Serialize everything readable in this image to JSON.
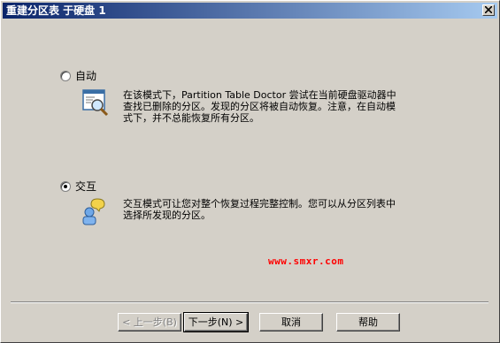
{
  "window": {
    "title": "重建分区表 于硬盘 1"
  },
  "options": [
    {
      "label": "自动",
      "checked": false,
      "description": [
        "在该模式下，Partition Table Doctor 尝试在当前硬盘驱动器中",
        "查找已删除的分区。发现的分区将被自动恢复。注意，在自动模",
        "式下，并不总能恢复所有分区。"
      ],
      "icon": "magnifier-window-icon"
    },
    {
      "label": "交互",
      "checked": true,
      "description": [
        "交互模式可让您对整个恢复过程完整控制。您可以从分区列表中",
        "选择所发现的分区。"
      ],
      "icon": "user-help-icon"
    }
  ],
  "watermark": "www.smxr.com",
  "buttons": {
    "back": "< 上一步(B)",
    "next": "下一步(N) >",
    "cancel": "取消",
    "help": "帮助"
  }
}
